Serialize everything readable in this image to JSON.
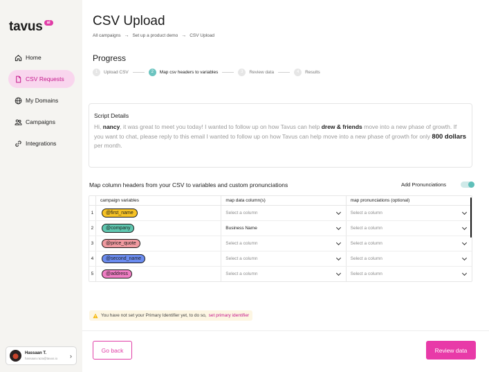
{
  "brand": {
    "name": "tavus",
    "badge": "ai",
    "accent": "#e03ca6"
  },
  "sidebar": {
    "items": [
      {
        "label": "Home",
        "icon": "home-icon",
        "active": false
      },
      {
        "label": "CSV Requests",
        "icon": "document-icon",
        "active": true
      },
      {
        "label": "My Domains",
        "icon": "globe-icon",
        "active": false
      },
      {
        "label": "Campaigns",
        "icon": "people-icon",
        "active": false
      },
      {
        "label": "Integrations",
        "icon": "link-icon",
        "active": false
      }
    ],
    "user": {
      "name": "Hassaan T.",
      "email": "hassaan.raza@tavus.io"
    }
  },
  "page": {
    "title": "CSV Upload",
    "breadcrumb": [
      "All campaigns",
      "Set up a product demo",
      "CSV Upload"
    ]
  },
  "progress": {
    "label": "Progress",
    "steps": [
      {
        "num": "1",
        "label": "Upload CSV",
        "active": false
      },
      {
        "num": "2",
        "label": "Map csv headers to variables",
        "active": true
      },
      {
        "num": "3",
        "label": "Review data",
        "active": false
      },
      {
        "num": "4",
        "label": "Results",
        "active": false
      }
    ]
  },
  "script": {
    "title": "Script Details",
    "p1": "Hi, ",
    "v1": "nancy",
    "p2": ", it was great to meet you today!  I wanted to follow up on how Tavus can help ",
    "v2": "drew & friends",
    "p3": " move into a new phase of growth. If you want to chat, please reply to this email I wanted to follow up on how Tavus can help move into a new phase of growth for only ",
    "v3": "800 dollars",
    "p4": " per month."
  },
  "mapping": {
    "label": "Map column headers from your CSV to variables and custom pronunciations",
    "toggle_label": "Add Pronunciations",
    "toggle_on": true,
    "columns": [
      "campaign variables",
      "map data column(s)",
      "map pronunciations (optional)"
    ],
    "rows": [
      {
        "num": "1",
        "variable": "@first_name",
        "color": "#f7c325",
        "data_col": "Select a column",
        "pron": "Select a column"
      },
      {
        "num": "2",
        "variable": "@company",
        "color": "#5fc7b0",
        "data_col": "Business Name",
        "pron": "Select a column"
      },
      {
        "num": "3",
        "variable": "@price_quote",
        "color": "#f19aa0",
        "data_col": "Select a column",
        "pron": "Select a column"
      },
      {
        "num": "4",
        "variable": "@second_name",
        "color": "#6b8cf0",
        "data_col": "Select a column",
        "pron": "Select a column"
      },
      {
        "num": "5",
        "variable": "@address",
        "color": "#f07ec4",
        "data_col": "Select a column",
        "pron": "Select a column"
      }
    ]
  },
  "warning": {
    "text": "You have not set your Primary Identifier yet, to do so,",
    "link": "set primary identifier"
  },
  "actions": {
    "back": "Go back",
    "review": "Review data"
  }
}
